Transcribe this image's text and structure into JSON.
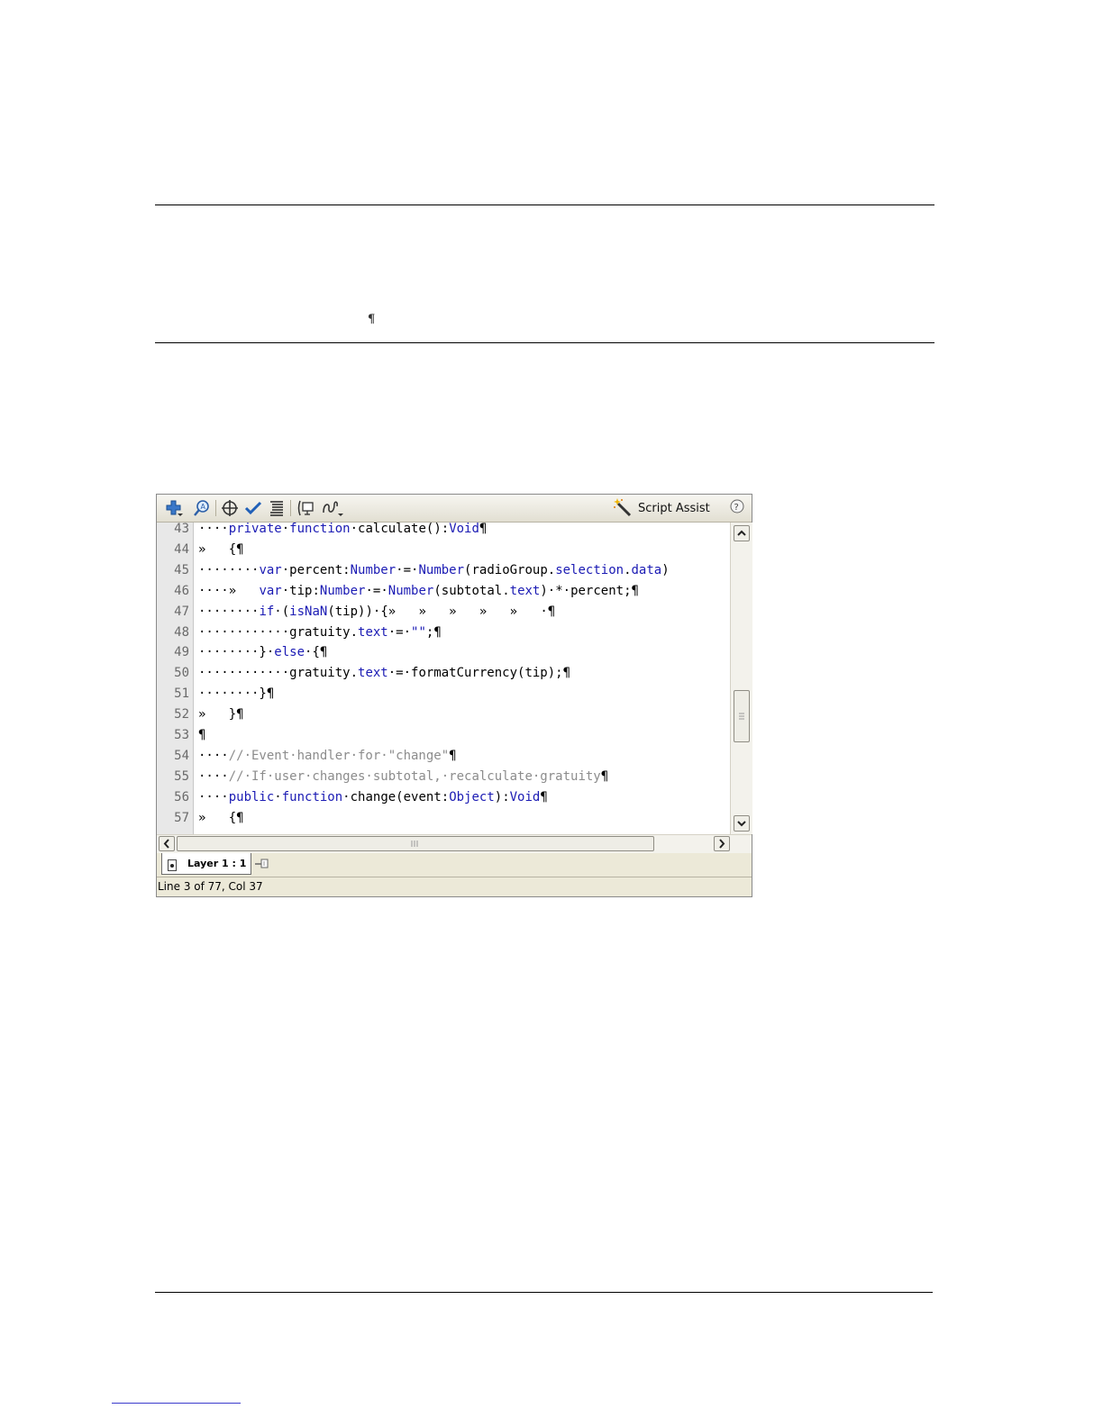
{
  "page": {
    "pilcrow": "¶"
  },
  "toolbar": {
    "icons": [
      "add-statement-icon",
      "find-icon",
      "insert-target-path-icon",
      "check-syntax-icon",
      "auto-format-icon",
      "show-code-hint-icon",
      "debug-options-icon"
    ],
    "script_assist_label": "Script Assist",
    "help_icon": "help-icon"
  },
  "code": {
    "lines": [
      {
        "num": "43",
        "segments": [
          [
            "pm",
            "····"
          ],
          [
            "kw",
            "private"
          ],
          [
            "pm",
            "·"
          ],
          [
            "kw",
            "function"
          ],
          [
            "pm",
            "·calculate():"
          ],
          [
            "kw",
            "Void"
          ],
          [
            "pm",
            "¶"
          ]
        ]
      },
      {
        "num": "44",
        "segments": [
          [
            "pm",
            "»   {¶"
          ]
        ]
      },
      {
        "num": "45",
        "segments": [
          [
            "pm",
            "········"
          ],
          [
            "kw",
            "var"
          ],
          [
            "pm",
            "·percent:"
          ],
          [
            "kw",
            "Number"
          ],
          [
            "pm",
            "·=·"
          ],
          [
            "kw",
            "Number"
          ],
          [
            "pm",
            "(radioGroup."
          ],
          [
            "kw",
            "selection"
          ],
          [
            "pm",
            "."
          ],
          [
            "kw",
            "data"
          ],
          [
            "pm",
            ")"
          ]
        ]
      },
      {
        "num": "46",
        "segments": [
          [
            "pm",
            "····»   "
          ],
          [
            "kw",
            "var"
          ],
          [
            "pm",
            "·tip:"
          ],
          [
            "kw",
            "Number"
          ],
          [
            "pm",
            "·=·"
          ],
          [
            "kw",
            "Number"
          ],
          [
            "pm",
            "(subtotal."
          ],
          [
            "kw",
            "text"
          ],
          [
            "pm",
            ")·*·percent;¶"
          ]
        ]
      },
      {
        "num": "47",
        "segments": [
          [
            "pm",
            "········"
          ],
          [
            "kw",
            "if"
          ],
          [
            "pm",
            "·("
          ],
          [
            "kw",
            "isNaN"
          ],
          [
            "pm",
            "(tip))·{»   »   »   »   »   ·¶"
          ]
        ]
      },
      {
        "num": "48",
        "segments": [
          [
            "pm",
            "············gratuity."
          ],
          [
            "kw",
            "text"
          ],
          [
            "pm",
            "·=·"
          ],
          [
            "kw",
            "\"\""
          ],
          [
            "pm",
            ";¶"
          ]
        ]
      },
      {
        "num": "49",
        "segments": [
          [
            "pm",
            "········}·"
          ],
          [
            "kw",
            "else"
          ],
          [
            "pm",
            "·{¶"
          ]
        ]
      },
      {
        "num": "50",
        "segments": [
          [
            "pm",
            "············gratuity."
          ],
          [
            "kw",
            "text"
          ],
          [
            "pm",
            "·=·formatCurrency(tip);¶"
          ]
        ]
      },
      {
        "num": "51",
        "segments": [
          [
            "pm",
            "········}¶"
          ]
        ]
      },
      {
        "num": "52",
        "segments": [
          [
            "pm",
            "»   }¶"
          ]
        ]
      },
      {
        "num": "53",
        "segments": [
          [
            "pm",
            "¶"
          ]
        ]
      },
      {
        "num": "54",
        "segments": [
          [
            "pm",
            "····"
          ],
          [
            "cm",
            "//·Event·handler·for·\"change\""
          ],
          [
            "pm",
            "¶"
          ]
        ]
      },
      {
        "num": "55",
        "segments": [
          [
            "pm",
            "····"
          ],
          [
            "cm",
            "//·If·user·changes·subtotal,·recalculate·gratuity"
          ],
          [
            "pm",
            "¶"
          ]
        ]
      },
      {
        "num": "56",
        "segments": [
          [
            "pm",
            "····"
          ],
          [
            "kw",
            "public"
          ],
          [
            "pm",
            "·"
          ],
          [
            "kw",
            "function"
          ],
          [
            "pm",
            "·change(event:"
          ],
          [
            "kw",
            "Object"
          ],
          [
            "pm",
            "):"
          ],
          [
            "kw",
            "Void"
          ],
          [
            "pm",
            "¶"
          ]
        ]
      },
      {
        "num": "57",
        "segments": [
          [
            "pm",
            "»   {¶"
          ]
        ]
      }
    ]
  },
  "tabs": {
    "layer_label": "Layer 1 : 1"
  },
  "status": {
    "text": "Line 3 of 77, Col 37"
  }
}
